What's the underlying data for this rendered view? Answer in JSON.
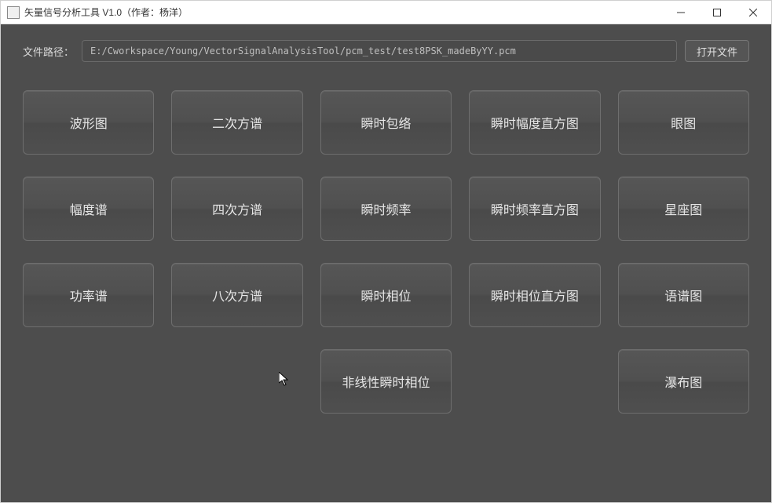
{
  "window": {
    "title": "矢量信号分析工具 V1.0（作者：杨洋）"
  },
  "fileRow": {
    "label": "文件路径：",
    "path": "E:/Cworkspace/Young/VectorSignalAnalysisTool/pcm_test/test8PSK_madeByYY.pcm",
    "openLabel": "打开文件"
  },
  "buttons": {
    "r0c0": "波形图",
    "r0c1": "二次方谱",
    "r0c2": "瞬时包络",
    "r0c3": "瞬时幅度直方图",
    "r0c4": "眼图",
    "r1c0": "幅度谱",
    "r1c1": "四次方谱",
    "r1c2": "瞬时频率",
    "r1c3": "瞬时频率直方图",
    "r1c4": "星座图",
    "r2c0": "功率谱",
    "r2c1": "八次方谱",
    "r2c2": "瞬时相位",
    "r2c3": "瞬时相位直方图",
    "r2c4": "语谱图",
    "r3c2": "非线性瞬时相位",
    "r3c4": "瀑布图"
  }
}
